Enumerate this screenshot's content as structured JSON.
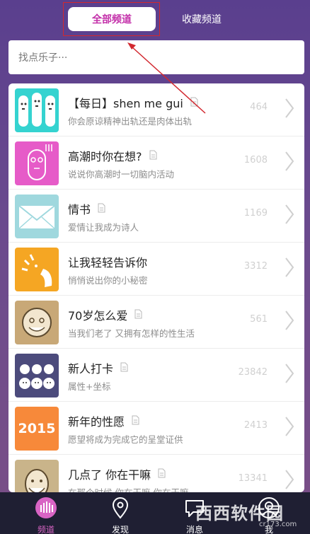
{
  "tabs": {
    "all": "全部频道",
    "favorites": "收藏频道"
  },
  "search": {
    "placeholder": "找点乐子···"
  },
  "channels": [
    {
      "title": "【每日】shen me gui",
      "desc": "你会原谅精神出轨还是肉体出轨",
      "count": "464",
      "thumb_color": "#35d3d0",
      "icon": "ghost-family-icon"
    },
    {
      "title": "高潮时你在想?",
      "desc": "说说你高潮时一切脑内活动",
      "count": "1608",
      "thumb_color": "#e65bc8",
      "icon": "face-symbol-icon"
    },
    {
      "title": "情书",
      "desc": "爱情让我成为诗人",
      "count": "1169",
      "thumb_color": "#9fd8de",
      "icon": "envelope-icon"
    },
    {
      "title": "让我轻轻告诉你",
      "desc": "悄悄说出你的小秘密",
      "count": "3312",
      "thumb_color": "#f5a623",
      "icon": "whisper-icon"
    },
    {
      "title": "70岁怎么爱",
      "desc": "当我们老了 又拥有怎样的性生活",
      "count": "561",
      "thumb_color": "#c8a877",
      "icon": "old-man-icon"
    },
    {
      "title": "新人打卡",
      "desc": "属性+坐标",
      "count": "23842",
      "thumb_color": "#4c4b7c",
      "icon": "crowd-icon"
    },
    {
      "title": "新年的性愿",
      "desc": "愿望将成为完成它的呈堂证供",
      "count": "2413",
      "thumb_color": "#f7893a",
      "icon": "year-2015-icon",
      "thumb_text": "2015"
    },
    {
      "title": "几点了 你在干嘛",
      "desc": "在那个时候 你在干嘛 你在干嘛",
      "count": "13341",
      "thumb_color": "#c9b48a",
      "icon": "bearded-man-icon"
    }
  ],
  "bottom_nav": [
    {
      "label": "频道",
      "icon": "channels-icon",
      "active": true
    },
    {
      "label": "发现",
      "icon": "location-pin-icon",
      "active": false
    },
    {
      "label": "消息",
      "icon": "chat-bubble-icon",
      "active": false
    },
    {
      "label": "我",
      "icon": "profile-icon",
      "active": false
    }
  ],
  "watermark": {
    "text": "西西软件园",
    "sub": "cr173.com"
  },
  "colors": {
    "accent": "#c32fa9",
    "annotation_red": "#d2282f",
    "nav_bg": "#1f1f33"
  }
}
